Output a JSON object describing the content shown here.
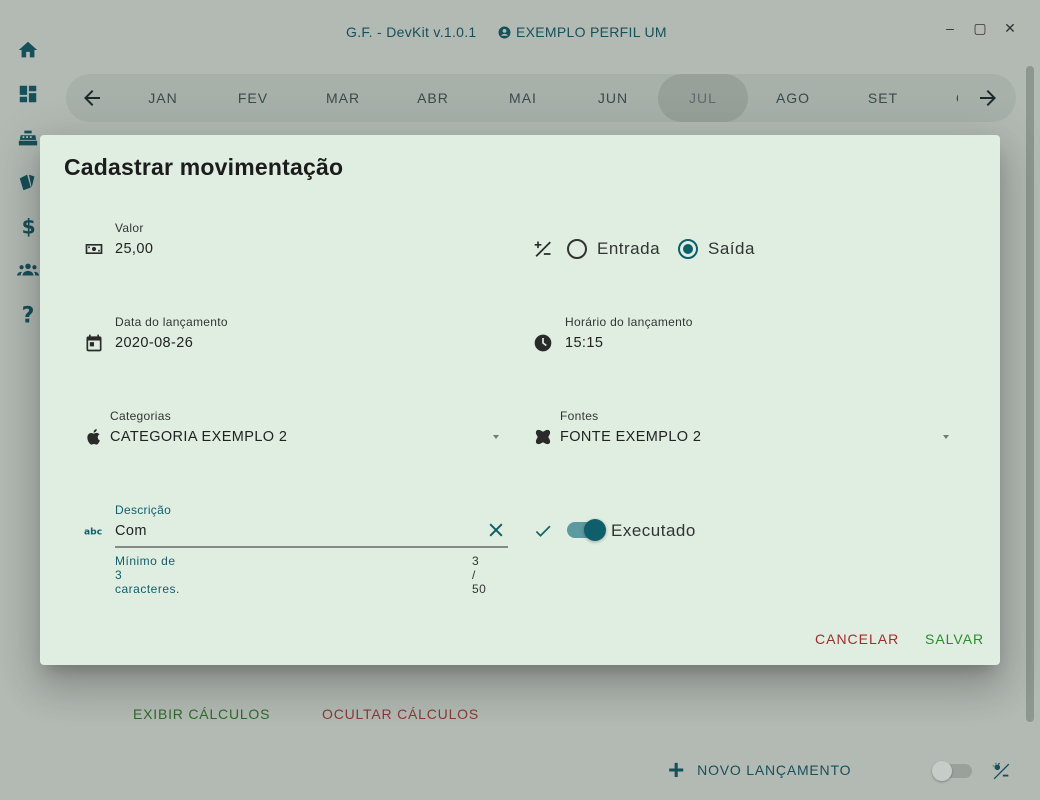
{
  "app": {
    "title": "G.F. - DevKit v.1.0.1",
    "profile": "EXEMPLO PERFIL UM"
  },
  "window": {
    "minimize": "–",
    "maximize": "▢",
    "close": "✕"
  },
  "nav_rail": [
    "home-icon",
    "dashboard-icon",
    "cash-register-icon",
    "cards-icon",
    "dollar-icon",
    "people-icon",
    "help-icon"
  ],
  "months": {
    "items": [
      "JAN",
      "FEV",
      "MAR",
      "ABR",
      "MAI",
      "JUN",
      "JUL",
      "AGO",
      "SET",
      "OUT"
    ],
    "active": "JUL"
  },
  "background": {
    "show_calc": "EXIBIR CÁLCULOS",
    "hide_calc": "OCULTAR CÁLCULOS",
    "new_entry": "NOVO LANÇAMENTO"
  },
  "dialog": {
    "title": "Cadastrar movimentação",
    "valor": {
      "label": "Valor",
      "value": "25,00"
    },
    "type": {
      "options": [
        "Entrada",
        "Saída"
      ],
      "selected": "Saída"
    },
    "date": {
      "label": "Data do lançamento",
      "value": "2020-08-26"
    },
    "time": {
      "label": "Horário do lançamento",
      "value": "15:15"
    },
    "category": {
      "label": "Categorias",
      "value": "CATEGORIA EXEMPLO 2"
    },
    "source": {
      "label": "Fontes",
      "value": "FONTE EXEMPLO 2"
    },
    "description": {
      "label": "Descrição",
      "value": "Com",
      "hint": "Mínimo de 3 caracteres.",
      "counter": "3 / 50"
    },
    "executed": {
      "label": "Executado",
      "on": true
    },
    "buttons": {
      "cancel": "CANCELAR",
      "save": "SALVAR"
    }
  },
  "colors": {
    "primary": "#0f5f6a",
    "dialog_bg": "#dfeee1",
    "cancel": "#a12c2c",
    "save": "#2e8b2e"
  }
}
